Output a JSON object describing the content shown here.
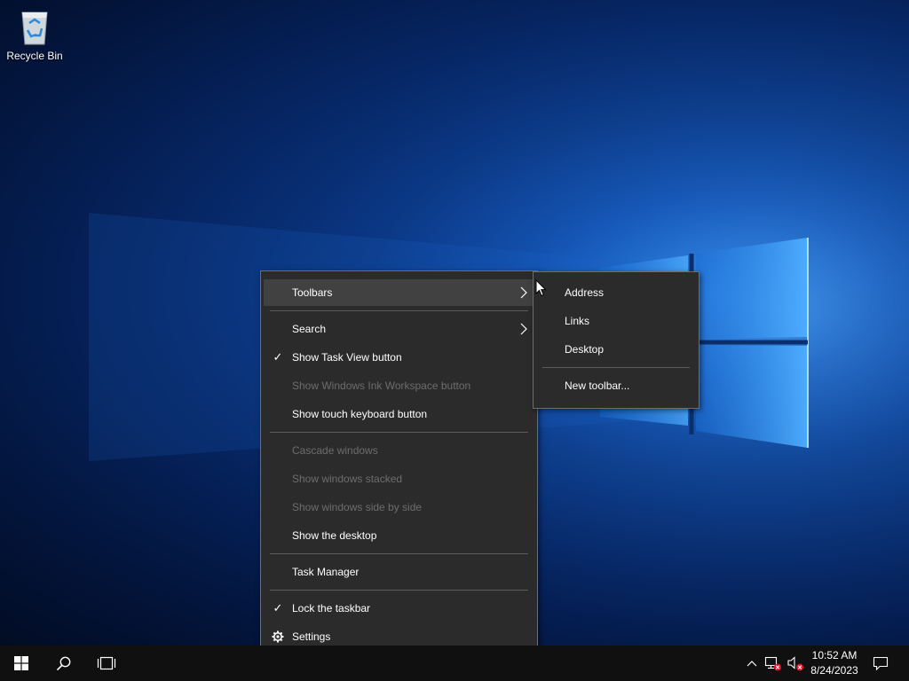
{
  "desktop": {
    "icons": [
      {
        "label": "Recycle Bin",
        "icon": "recycle-bin-icon"
      }
    ]
  },
  "context_menu": {
    "items": [
      {
        "label": "Toolbars",
        "checked": false,
        "disabled": false,
        "submenu": true,
        "highlighted": true
      },
      {
        "label": "Search",
        "checked": false,
        "disabled": false,
        "submenu": true
      },
      {
        "label": "Show Task View button",
        "checked": true,
        "disabled": false
      },
      {
        "label": "Show Windows Ink Workspace button",
        "checked": false,
        "disabled": true
      },
      {
        "label": "Show touch keyboard button",
        "checked": false,
        "disabled": false
      },
      {
        "label": "Cascade windows",
        "checked": false,
        "disabled": true
      },
      {
        "label": "Show windows stacked",
        "checked": false,
        "disabled": true
      },
      {
        "label": "Show windows side by side",
        "checked": false,
        "disabled": true
      },
      {
        "label": "Show the desktop",
        "checked": false,
        "disabled": false
      },
      {
        "label": "Task Manager",
        "checked": false,
        "disabled": false
      },
      {
        "label": "Lock the taskbar",
        "checked": true,
        "disabled": false
      },
      {
        "label": "Settings",
        "icon": "gear-icon",
        "disabled": false
      }
    ],
    "check_glyph": "✓"
  },
  "toolbars_submenu": {
    "items": [
      {
        "label": "Address"
      },
      {
        "label": "Links"
      },
      {
        "label": "Desktop"
      },
      {
        "label": "New toolbar..."
      }
    ]
  },
  "taskbar": {
    "start_icon": "windows-logo-icon",
    "search_icon": "search-icon",
    "task_view_icon": "task-view-icon",
    "tray": {
      "chevron_icon": "chevron-up-icon",
      "network_icon": "network-disconnected-icon",
      "volume_icon": "volume-muted-icon",
      "notification_icon": "action-center-icon"
    },
    "clock": {
      "time": "10:52 AM",
      "date": "8/24/2023"
    }
  },
  "colors": {
    "menu_bg": "#2b2b2b",
    "menu_highlight": "#414141",
    "menu_disabled_text": "#6d6d6d",
    "taskbar_bg": "#101010",
    "tray_error_badge": "#e81123"
  }
}
